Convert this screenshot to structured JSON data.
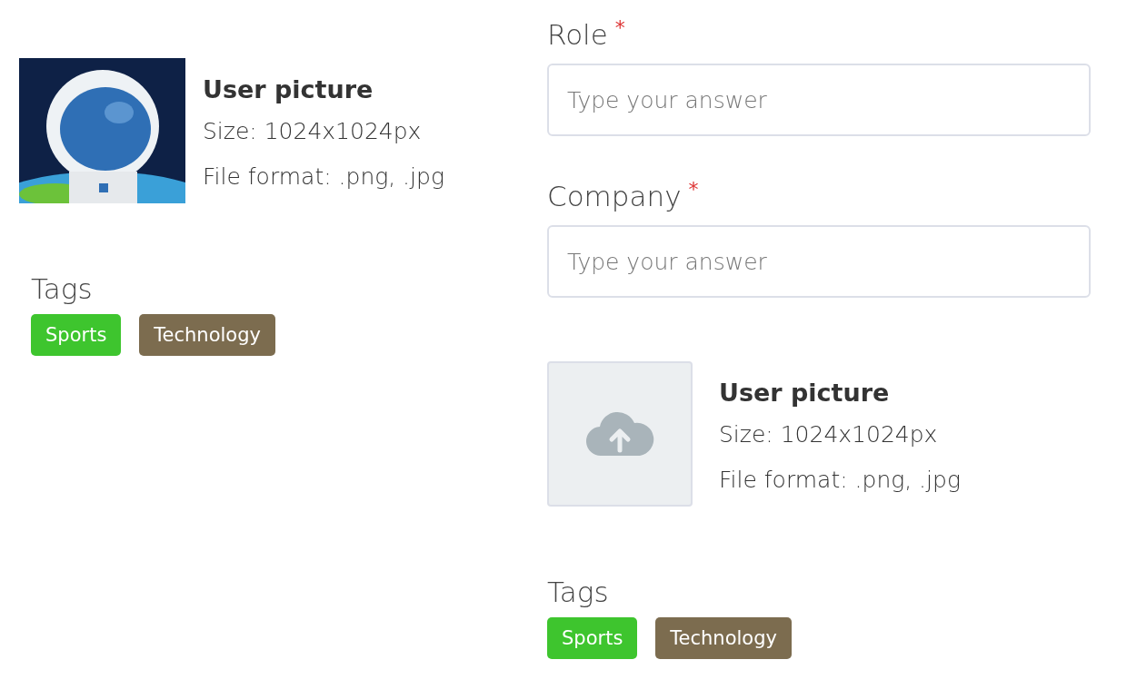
{
  "left": {
    "picture": {
      "kind": "image",
      "title": "User picture",
      "size": "Size: 1024x1024px",
      "format": "File format: .png, .jpg"
    },
    "tags": {
      "label": "Tags",
      "items": [
        {
          "label": "Sports",
          "color": "#3ec52e"
        },
        {
          "label": "Technology",
          "color": "#7c6c4f"
        }
      ]
    }
  },
  "right": {
    "fields": [
      {
        "label": "Role",
        "required_mark": "*",
        "placeholder": "Type your answer"
      },
      {
        "label": "Company",
        "required_mark": "*",
        "placeholder": "Type your answer"
      }
    ],
    "picture": {
      "kind": "upload",
      "title": "User picture",
      "size": "Size: 1024x1024px",
      "format": "File format: .png, .jpg"
    },
    "tags": {
      "label": "Tags",
      "items": [
        {
          "label": "Sports",
          "color": "#3ec52e"
        },
        {
          "label": "Technology",
          "color": "#7c6c4f"
        }
      ]
    }
  }
}
